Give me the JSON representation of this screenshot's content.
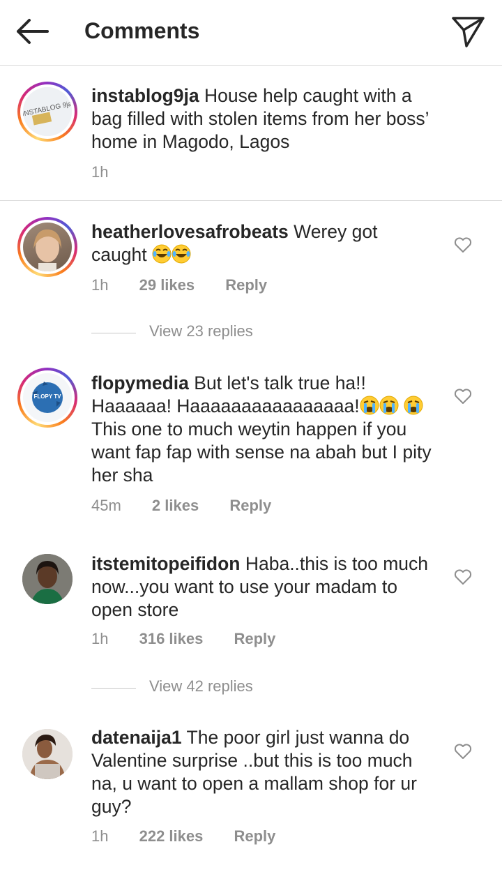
{
  "header": {
    "title": "Comments"
  },
  "caption": {
    "username": "instablog9ja",
    "text": "House help caught with a bag filled with stolen items from her boss’ home in Magodo, Lagos",
    "time": "1h"
  },
  "comments": [
    {
      "username": "heatherlovesafrobeats",
      "text": "Werey got caught",
      "time": "1h",
      "likes": "29 likes",
      "reply": "Reply",
      "view_replies": "View 23 replies"
    },
    {
      "username": "flopymedia",
      "text_a": "But let's talk true ha!! Haaaaaa! Haaaaaaaaaaaaaaaa!",
      "text_b": " This one to much weytin happen if you want fap fap with sense na abah but I pity her sha",
      "time": "45m",
      "likes": "2 likes",
      "reply": "Reply"
    },
    {
      "username": "itstemitopeifidon",
      "text": "Haba..this is too much now...you want to use your madam to open store",
      "time": "1h",
      "likes": "316 likes",
      "reply": "Reply",
      "view_replies": "View 42 replies"
    },
    {
      "username": "datenaija1",
      "text": "The poor girl just wanna do Valentine surprise ..but this is too much na, u want to open a mallam shop for ur guy?",
      "time": "1h",
      "likes": "222 likes",
      "reply": "Reply"
    }
  ],
  "logos": {
    "caption_avatar": "INSTABLOG 9ja",
    "flopy_avatar": "FLOPY TV"
  },
  "colors": {
    "text": "#262626",
    "secondary": "#8e8e8e",
    "divider": "#dbdbdb"
  }
}
